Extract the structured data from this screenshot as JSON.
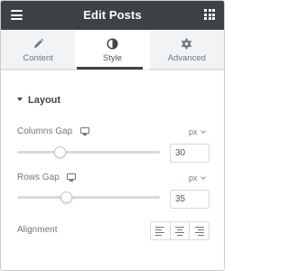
{
  "header": {
    "title": "Edit Posts",
    "menu_icon": "hamburger-menu-icon",
    "apps_icon": "grid-apps-icon"
  },
  "tabs": [
    {
      "label": "Content",
      "icon": "pencil-icon",
      "active": false
    },
    {
      "label": "Style",
      "icon": "half-circle-icon",
      "active": true
    },
    {
      "label": "Advanced",
      "icon": "gear-icon",
      "active": false
    }
  ],
  "section": {
    "title": "Layout",
    "controls": {
      "columns_gap": {
        "label": "Columns Gap",
        "unit": "px",
        "value": "30",
        "slider_fraction": 0.3
      },
      "rows_gap": {
        "label": "Rows Gap",
        "unit": "px",
        "value": "35",
        "slider_fraction": 0.35
      },
      "alignment": {
        "label": "Alignment",
        "options": [
          "align-left-icon",
          "align-center-icon",
          "align-right-icon"
        ]
      }
    }
  },
  "colors": {
    "header_bg": "#3e4246",
    "tab_inactive_bg": "#f1f3f5",
    "text": "#6d7882"
  }
}
